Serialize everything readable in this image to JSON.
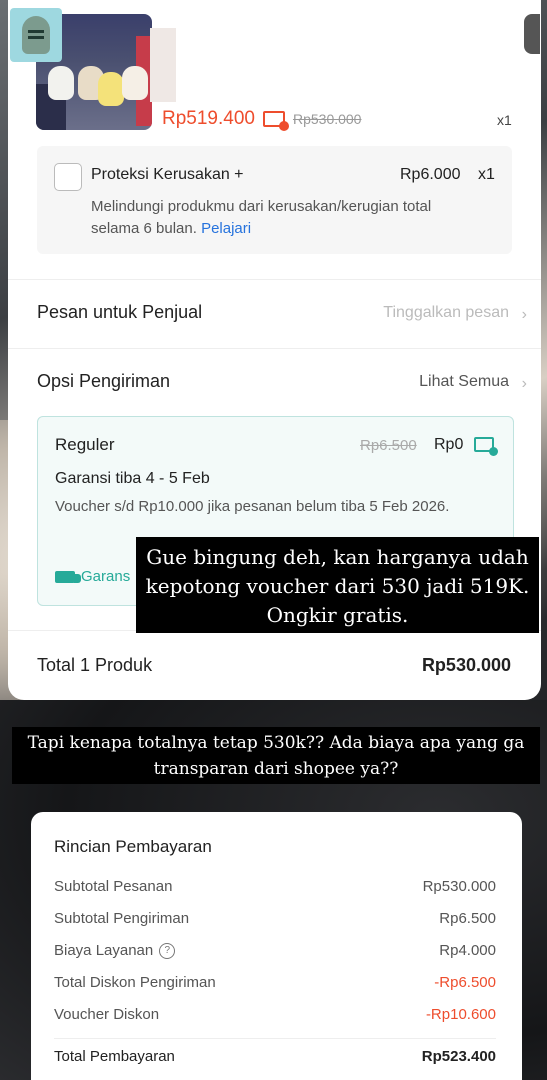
{
  "product": {
    "price_now": "Rp519.400",
    "price_old": "Rp530.000",
    "quantity": "x1",
    "voucher_icon": "voucher-ticket-icon"
  },
  "protection": {
    "title": "Proteksi Kerusakan +",
    "price": "Rp6.000",
    "quantity": "x1",
    "description": "Melindungi produkmu dari kerusakan/kerugian total selama 6 bulan.",
    "learn_more": "Pelajari"
  },
  "message_row": {
    "label": "Pesan untuk Penjual",
    "placeholder": "Tinggalkan pesan"
  },
  "shipping_row": {
    "label": "Opsi Pengiriman",
    "see_all": "Lihat Semua"
  },
  "shipping_option": {
    "name": "Reguler",
    "price_old": "Rp6.500",
    "price_now": "Rp0",
    "eta": "Garansi tiba 4 - 5 Feb",
    "voucher_note": "Voucher s/d  Rp10.000 jika pesanan belum tiba 5 Feb 2026.",
    "guarantee": "Garans"
  },
  "order_total": {
    "label": "Total 1 Produk",
    "value": "Rp530.000"
  },
  "captions": {
    "first": "Gue bingung deh, kan harganya udah kepotong voucher dari 530 jadi 519K. Ongkir gratis.",
    "second": "Tapi kenapa totalnya tetap 530k?? Ada biaya apa yang ga transparan dari shopee ya??"
  },
  "payment": {
    "title": "Rincian Pembayaran",
    "rows": [
      {
        "label": "Subtotal Pesanan",
        "value": "Rp530.000"
      },
      {
        "label": "Subtotal Pengiriman",
        "value": "Rp6.500"
      },
      {
        "label": "Biaya Layanan",
        "value": "Rp4.000"
      },
      {
        "label": "Total Diskon Pengiriman",
        "value": "-Rp6.500"
      },
      {
        "label": "Voucher Diskon",
        "value": "-Rp10.600"
      }
    ],
    "total_label": "Total Pembayaran",
    "total_value": "Rp523.400"
  },
  "colors": {
    "accent": "#ee4d2d",
    "teal": "#26aa99",
    "link": "#2673dd"
  }
}
